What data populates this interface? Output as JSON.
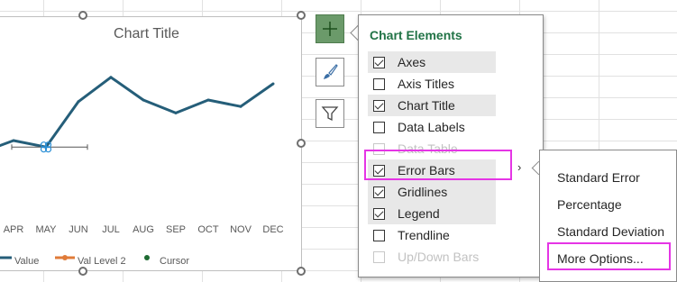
{
  "chart": {
    "title": "Chart Title",
    "legend": {
      "value_label": "Value",
      "val_level_label": "Val Level 2",
      "cursor_label": "Cursor"
    }
  },
  "chart_data": {
    "type": "line",
    "title": "Chart Title",
    "categories": [
      "APR",
      "MAY",
      "JUN",
      "JUL",
      "AUG",
      "SEP",
      "OCT",
      "NOV",
      "DEC"
    ],
    "series": [
      {
        "name": "Value",
        "values": [
          45,
          41,
          69,
          84,
          70,
          62,
          70,
          66,
          80
        ],
        "color": "#255e79"
      }
    ],
    "cursor": {
      "category": "MAY",
      "value": 41
    },
    "legend_position": "bottom",
    "grid": false
  },
  "side_buttons": {
    "chart_elements": "plus-icon",
    "chart_styles": "brush-icon",
    "chart_filters": "funnel-icon"
  },
  "panel": {
    "title": "Chart Elements",
    "items": [
      {
        "label": "Axes",
        "checked": true,
        "highlight": true,
        "disabled": false
      },
      {
        "label": "Axis Titles",
        "checked": false,
        "highlight": false,
        "disabled": false
      },
      {
        "label": "Chart Title",
        "checked": true,
        "highlight": true,
        "disabled": false
      },
      {
        "label": "Data Labels",
        "checked": false,
        "highlight": false,
        "disabled": false
      },
      {
        "label": "Data Table",
        "checked": false,
        "highlight": false,
        "disabled": true
      },
      {
        "label": "Error Bars",
        "checked": true,
        "highlight": true,
        "disabled": false
      },
      {
        "label": "Gridlines",
        "checked": true,
        "highlight": true,
        "disabled": false
      },
      {
        "label": "Legend",
        "checked": true,
        "highlight": true,
        "disabled": false
      },
      {
        "label": "Trendline",
        "checked": false,
        "highlight": false,
        "disabled": false
      },
      {
        "label": "Up/Down Bars",
        "checked": false,
        "highlight": false,
        "disabled": true
      }
    ]
  },
  "submenu": {
    "items": [
      "Standard Error",
      "Percentage",
      "Standard Deviation",
      "More Options..."
    ]
  },
  "colors": {
    "accent": "#217346",
    "highlight_box": "#e535e5",
    "series_value": "#255e79",
    "series_val_level": "#e07b39",
    "cursor": "#1e6b32"
  }
}
